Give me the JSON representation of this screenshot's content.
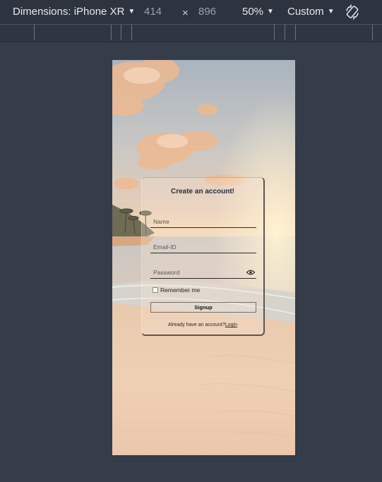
{
  "toolbar": {
    "dimensions_label": "Dimensions: iPhone XR",
    "width_value": "414",
    "separator": "×",
    "height_value": "896",
    "zoom_label": "50%",
    "throttle_label": "Custom",
    "icons": {
      "caret": "chevron-down-icon",
      "rotate": "rotate-device-icon"
    }
  },
  "form": {
    "title": "Create an account!",
    "name_placeholder": "Name",
    "email_placeholder": "Email-ID",
    "password_placeholder": "Password",
    "remember_label": "Remember me",
    "signup_label": "Signup",
    "footer_text": "Already have an account?",
    "login_link": "Login",
    "icons": {
      "password_toggle": "eye-icon"
    }
  },
  "colors": {
    "toolbar_bg": "#2d333f",
    "page_bg": "#353c4a",
    "card_border": "#5e5550",
    "text_dark": "#2a2f3a"
  }
}
